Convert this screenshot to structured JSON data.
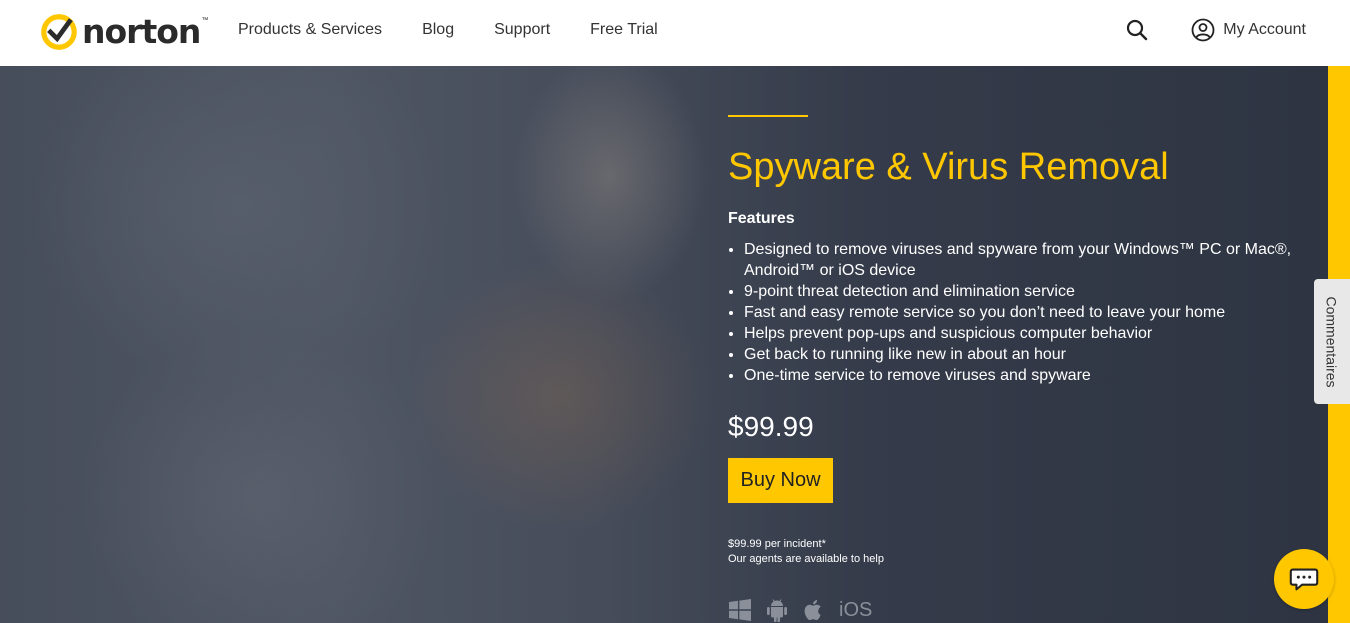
{
  "brand": {
    "name": "norton",
    "tm": "™",
    "accent": "#ffc700"
  },
  "nav": {
    "items": [
      "Products & Services",
      "Blog",
      "Support",
      "Free Trial"
    ]
  },
  "header": {
    "account_label": "My Account"
  },
  "hero": {
    "title": "Spyware & Virus Removal",
    "features_label": "Features",
    "features": [
      "Designed to remove viruses and spyware from your Windows™ PC or Mac®, Android™ or iOS device",
      "9-point threat detection and elimination service",
      "Fast and easy remote service so you don’t need to leave your home",
      "Helps prevent pop-ups and suspicious computer behavior",
      "Get back to running like new in about an hour",
      "One-time service to remove viruses and spyware"
    ],
    "price": "$99.99",
    "buy_label": "Buy Now",
    "note_price": "$99.99 per incident*",
    "note_agents": "Our agents are available to help",
    "platforms": [
      "windows-icon",
      "android-icon",
      "apple-icon"
    ],
    "ios_label": "iOS"
  },
  "side_tab": {
    "label": "Commentaires"
  }
}
